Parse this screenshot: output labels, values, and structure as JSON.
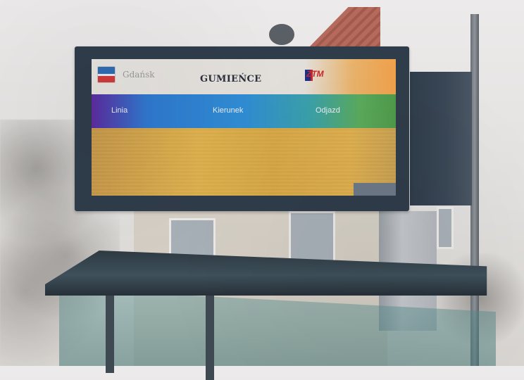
{
  "display": {
    "header": {
      "city_logo_name": "Gdańsk",
      "stop_name": "GUMIEŃCE",
      "operator_logo": "ZTM"
    },
    "columns": [
      {
        "label": "Linia"
      },
      {
        "label": "Kierunek"
      },
      {
        "label": "Odjazd"
      }
    ]
  }
}
